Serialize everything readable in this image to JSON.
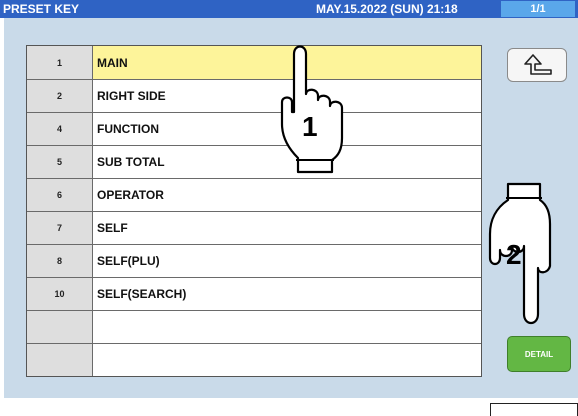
{
  "header": {
    "title": "PRESET KEY",
    "datetime": "MAY.15.2022 (SUN)  21:18",
    "page": "1/1"
  },
  "list": {
    "rows": [
      {
        "num": "1",
        "name": "MAIN",
        "selected": true
      },
      {
        "num": "2",
        "name": "RIGHT SIDE"
      },
      {
        "num": "4",
        "name": "FUNCTION"
      },
      {
        "num": "5",
        "name": "SUB TOTAL"
      },
      {
        "num": "6",
        "name": "OPERATOR"
      },
      {
        "num": "7",
        "name": "SELF"
      },
      {
        "num": "8",
        "name": "SELF(PLU)"
      },
      {
        "num": "10",
        "name": "SELF(SEARCH)"
      },
      {
        "num": "",
        "name": ""
      },
      {
        "num": "",
        "name": ""
      }
    ]
  },
  "buttons": {
    "back_icon": "return-arrow-icon",
    "detail_label": "DETAIL"
  },
  "annotations": {
    "step1": "1",
    "step2": "2"
  },
  "colors": {
    "header": "#2f63c4",
    "page_badge": "#5aa7ea",
    "screen": "#c9dae9",
    "selected_row": "#fdf49a",
    "detail_button": "#63b744"
  }
}
